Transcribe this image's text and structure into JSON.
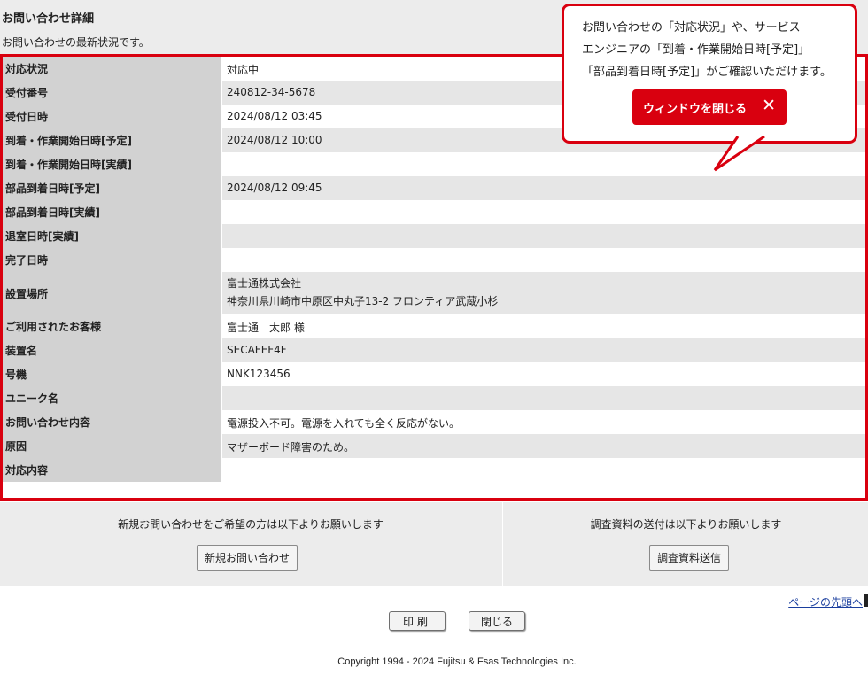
{
  "page": {
    "title": "お問い合わせ詳細",
    "subtitle": "お問い合わせの最新状況です。"
  },
  "details": [
    {
      "label": "対応状況",
      "value": "対応中"
    },
    {
      "label": "受付番号",
      "value": "240812-34-5678"
    },
    {
      "label": "受付日時",
      "value": "2024/08/12 03:45"
    },
    {
      "label": "到着・作業開始日時[予定]",
      "value": "2024/08/12 10:00"
    },
    {
      "label": "到着・作業開始日時[実績]",
      "value": ""
    },
    {
      "label": "部品到着日時[予定]",
      "value": "2024/08/12 09:45"
    },
    {
      "label": "部品到着日時[実績]",
      "value": ""
    },
    {
      "label": "退室日時[実績]",
      "value": ""
    },
    {
      "label": "完了日時",
      "value": ""
    },
    {
      "label": "設置場所",
      "value": "富士通株式会社",
      "value2": "神奈川県川崎市中原区中丸子13-2 フロンティア武蔵小杉"
    },
    {
      "label": "ご利用されたお客様",
      "value": "富士通　太郎 様"
    },
    {
      "label": "装置名",
      "value": "SECAFEF4F"
    },
    {
      "label": "号機",
      "value": "NNK123456"
    },
    {
      "label": "ユニーク名",
      "value": ""
    },
    {
      "label": "お問い合わせ内容",
      "value": "電源投入不可。電源を入れても全く反応がない。"
    },
    {
      "label": "原因",
      "value": "マザーボード障害のため。"
    },
    {
      "label": "対応内容",
      "value": ""
    }
  ],
  "panels": {
    "new_inquiry": {
      "text": "新規お問い合わせをご希望の方は以下よりお願いします",
      "button": "新規お問い合わせ"
    },
    "send_material": {
      "text": "調査資料の送付は以下よりお願いします",
      "button": "調査資料送信"
    }
  },
  "links": {
    "page_top": "ページの先頭へ"
  },
  "actions": {
    "print": "印刷",
    "close": "閉じる"
  },
  "footer": {
    "copyright": "Copyright 1994 - 2024 Fujitsu & Fsas Technologies Inc."
  },
  "callout": {
    "lines": [
      "お問い合わせの「対応状況」や、サービス",
      "エンジニアの「到着・作業開始日時[予定]」",
      "「部品到着日時[予定]」がご確認いただけます。"
    ],
    "close_button": "ウィンドウを閉じる",
    "close_icon": "close-icon"
  },
  "colors": {
    "accent": "#d9000f",
    "header_bg": "#d2d2d2",
    "panel_bg": "#ececec"
  }
}
